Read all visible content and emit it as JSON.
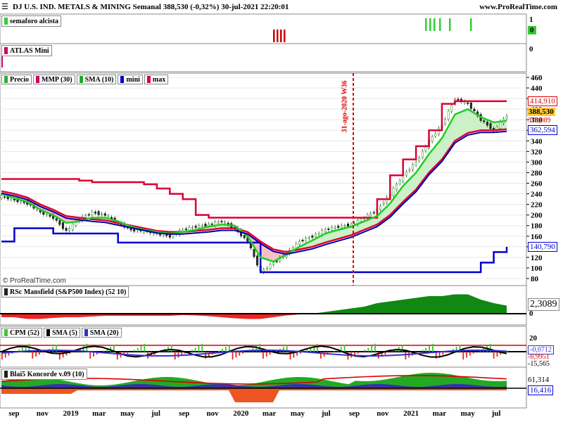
{
  "header": {
    "title": "DJ U.S. IND. METALS & MINING Semanal 388,530 (-0,32%) 30-jul-2021 22:20:01",
    "site": "www.ProRealTime.com"
  },
  "panels": {
    "semaforo": {
      "label": "semaforo alcista",
      "axis_ticks": [
        "1",
        "0"
      ],
      "last_value": "0"
    },
    "atlas": {
      "label": "ATLAS Mini",
      "axis_ticks": [
        "0"
      ]
    },
    "price": {
      "legend": [
        "Precio",
        "MMP (30)",
        "SMA (10)",
        "mini",
        "max"
      ],
      "legend_colors": [
        "#33aa33",
        "#cc0066",
        "#22aa22",
        "#0000cc",
        "#dd0033"
      ],
      "axis_ticks": [
        "460",
        "440",
        "420",
        "400",
        "380",
        "360",
        "340",
        "320",
        "300",
        "280",
        "260",
        "240",
        "220",
        "200",
        "180",
        "160",
        "140",
        "120",
        "100",
        "80"
      ],
      "labels": {
        "max": "414,910",
        "price": "388,530",
        "sma": "378,089",
        "mmp": "362,594",
        "mini": "140,790"
      },
      "vline_label": "31-ago-2020 W36",
      "watermark": "© ProRealTime.com"
    },
    "rsc": {
      "label": "RSc Mansfield (S&P500 Index) (52 10)",
      "last_value": "2,3089",
      "axis_ticks": [
        "0"
      ]
    },
    "cpm": {
      "legend": [
        "CPM (52)",
        "SMA (5)",
        "SMA (20)"
      ],
      "legend_colors": [
        "#33cc33",
        "#000000",
        "#3333cc"
      ],
      "axis_ticks": [
        "20"
      ],
      "values": [
        "-0,0712",
        "-8,9951",
        "-15,565"
      ]
    },
    "konkorde": {
      "label": "Blai5 Koncorde v.09 (10)",
      "values": [
        "61,314",
        "16,416"
      ]
    }
  },
  "x_axis": [
    "sep",
    "nov",
    "2019",
    "mar",
    "may",
    "jul",
    "sep",
    "nov",
    "2020",
    "mar",
    "may",
    "jul",
    "sep",
    "nov",
    "2021",
    "mar",
    "may",
    "jul"
  ],
  "chart_data": [
    {
      "type": "line",
      "title": "DJ U.S. IND. METALS & MINING Semanal",
      "ylim": [
        80,
        460
      ],
      "x_start": "2018-08",
      "x_end": "2021-07",
      "series": [
        {
          "name": "Precio",
          "values": [
            235,
            228,
            222,
            205,
            195,
            170,
            192,
            205,
            200,
            185,
            172,
            170,
            165,
            160,
            172,
            178,
            182,
            188,
            175,
            150,
            92,
            110,
            128,
            150,
            160,
            172,
            178,
            182,
            195,
            210,
            240,
            275,
            300,
            340,
            370,
            420,
            410,
            380,
            360,
            388
          ]
        },
        {
          "name": "SMA (10)",
          "values": [
            240,
            232,
            225,
            210,
            200,
            185,
            188,
            195,
            195,
            188,
            178,
            172,
            168,
            165,
            168,
            172,
            178,
            182,
            180,
            160,
            120,
            112,
            125,
            140,
            152,
            165,
            172,
            178,
            188,
            198,
            222,
            255,
            280,
            315,
            345,
            390,
            400,
            385,
            375,
            378
          ]
        },
        {
          "name": "MMP (30)",
          "values": [
            245,
            240,
            233,
            220,
            210,
            198,
            195,
            192,
            190,
            185,
            180,
            175,
            170,
            168,
            168,
            170,
            172,
            175,
            175,
            168,
            150,
            135,
            130,
            135,
            140,
            148,
            155,
            162,
            172,
            182,
            200,
            225,
            248,
            280,
            305,
            340,
            355,
            360,
            360,
            362
          ]
        },
        {
          "name": "mini",
          "values": [
            150,
            175,
            175,
            175,
            165,
            165,
            165,
            165,
            165,
            148,
            148,
            148,
            148,
            148,
            148,
            148,
            148,
            148,
            148,
            148,
            92,
            92,
            92,
            92,
            92,
            92,
            92,
            92,
            92,
            92,
            92,
            92,
            92,
            92,
            92,
            92,
            92,
            110,
            130,
            140
          ]
        },
        {
          "name": "max",
          "values": [
            268,
            268,
            268,
            268,
            268,
            268,
            265,
            262,
            262,
            262,
            262,
            258,
            250,
            240,
            230,
            200,
            195,
            195,
            195,
            195,
            195,
            195,
            195,
            195,
            195,
            195,
            195,
            195,
            195,
            230,
            275,
            305,
            330,
            360,
            410,
            415,
            415,
            415,
            415,
            415
          ]
        }
      ]
    },
    {
      "type": "area",
      "title": "RSc Mansfield (S&P500 Index) (52 10)",
      "series": [
        {
          "name": "RSc Mansfield",
          "values": [
            -1,
            -1,
            -1.5,
            -1.5,
            -1.2,
            -1,
            -1,
            -0.8,
            -0.6,
            -0.6,
            -0.6,
            -0.6,
            -0.6,
            -0.6,
            -0.4,
            -0.5,
            -0.7,
            -1,
            -1.3,
            -1.5,
            -1.5,
            -1,
            -0.5,
            -0.2,
            0,
            0.5,
            1,
            1.5,
            2,
            3,
            3.5,
            4,
            4.5,
            5,
            5,
            5.5,
            5.5,
            4,
            3,
            2.3
          ]
        }
      ]
    }
  ]
}
